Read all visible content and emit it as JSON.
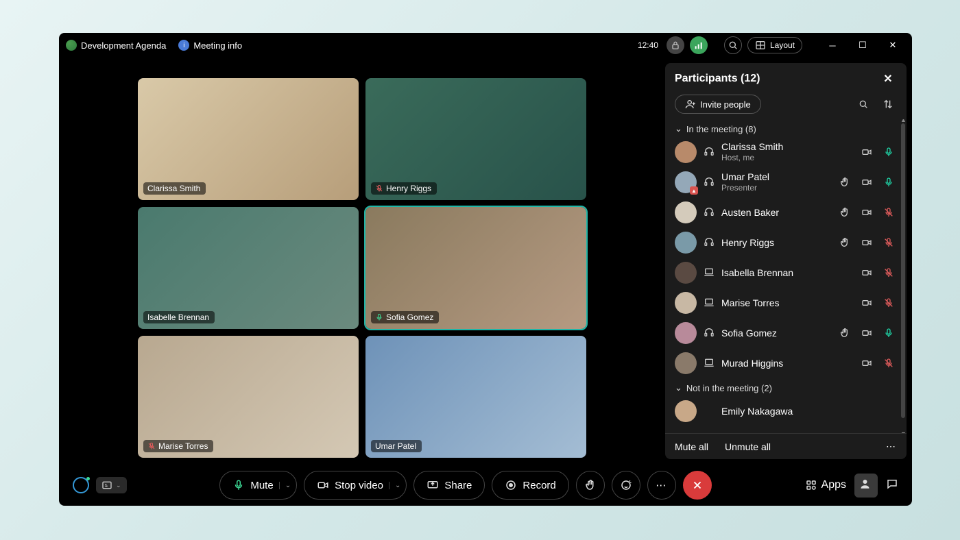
{
  "header": {
    "meeting_title": "Development Agenda",
    "meeting_info": "Meeting info",
    "time": "12:40",
    "layout_label": "Layout"
  },
  "tiles": [
    {
      "name": "Clarissa Smith",
      "muted": false,
      "speaking": false,
      "bg": "linear-gradient(135deg,#d9c9a8,#b79e7a)"
    },
    {
      "name": "Henry Riggs",
      "muted": true,
      "speaking": false,
      "bg": "linear-gradient(135deg,#3a6b5a,#28524a)"
    },
    {
      "name": "Isabelle Brennan",
      "muted": false,
      "speaking": false,
      "bg": "linear-gradient(135deg,#4a7a6e,#6b8a7e)"
    },
    {
      "name": "Sofia Gomez",
      "muted": false,
      "speaking": true,
      "bg": "linear-gradient(135deg,#8a7a5e,#b59a82)"
    },
    {
      "name": "Marise Torres",
      "muted": true,
      "speaking": false,
      "bg": "linear-gradient(135deg,#b8a890,#d4c8b4)"
    },
    {
      "name": "Umar Patel",
      "muted": false,
      "speaking": false,
      "bg": "linear-gradient(135deg,#6e92b8,#a4bdd4)"
    }
  ],
  "panel": {
    "title": "Participants (12)",
    "invite_label": "Invite people",
    "section_in": "In the meeting (8)",
    "section_out": "Not in the meeting (2)",
    "mute_all": "Mute all",
    "unmute_all": "Unmute all",
    "participants": [
      {
        "name": "Clarissa Smith",
        "role": "Host, me",
        "device": "headset",
        "hand": false,
        "video": true,
        "mic": "live",
        "badge": false,
        "avatar": "#b88a6a"
      },
      {
        "name": "Umar Patel",
        "role": "Presenter",
        "device": "headset",
        "hand": true,
        "video": true,
        "mic": "live",
        "badge": true,
        "avatar": "#94a8b8"
      },
      {
        "name": "Austen Baker",
        "role": "",
        "device": "headset",
        "hand": true,
        "video": true,
        "mic": "muted",
        "badge": false,
        "avatar": "#d4cbbb"
      },
      {
        "name": "Henry Riggs",
        "role": "",
        "device": "headset",
        "hand": true,
        "video": true,
        "mic": "muted",
        "badge": false,
        "avatar": "#7a9aa8"
      },
      {
        "name": "Isabella Brennan",
        "role": "",
        "device": "laptop",
        "hand": false,
        "video": true,
        "mic": "muted",
        "badge": false,
        "avatar": "#5a4a42"
      },
      {
        "name": "Marise Torres",
        "role": "",
        "device": "laptop",
        "hand": false,
        "video": true,
        "mic": "muted",
        "badge": false,
        "avatar": "#c8b8a4"
      },
      {
        "name": "Sofia Gomez",
        "role": "",
        "device": "headset",
        "hand": true,
        "video": true,
        "mic": "live",
        "badge": false,
        "avatar": "#b88a9a"
      },
      {
        "name": "Murad Higgins",
        "role": "",
        "device": "laptop",
        "hand": false,
        "video": true,
        "mic": "muted",
        "badge": false,
        "avatar": "#8a7a6a"
      }
    ],
    "not_in_meeting": [
      {
        "name": "Emily Nakagawa",
        "avatar": "#c8a888"
      }
    ]
  },
  "controls": {
    "mute": "Mute",
    "stop_video": "Stop video",
    "share": "Share",
    "record": "Record",
    "apps": "Apps"
  }
}
